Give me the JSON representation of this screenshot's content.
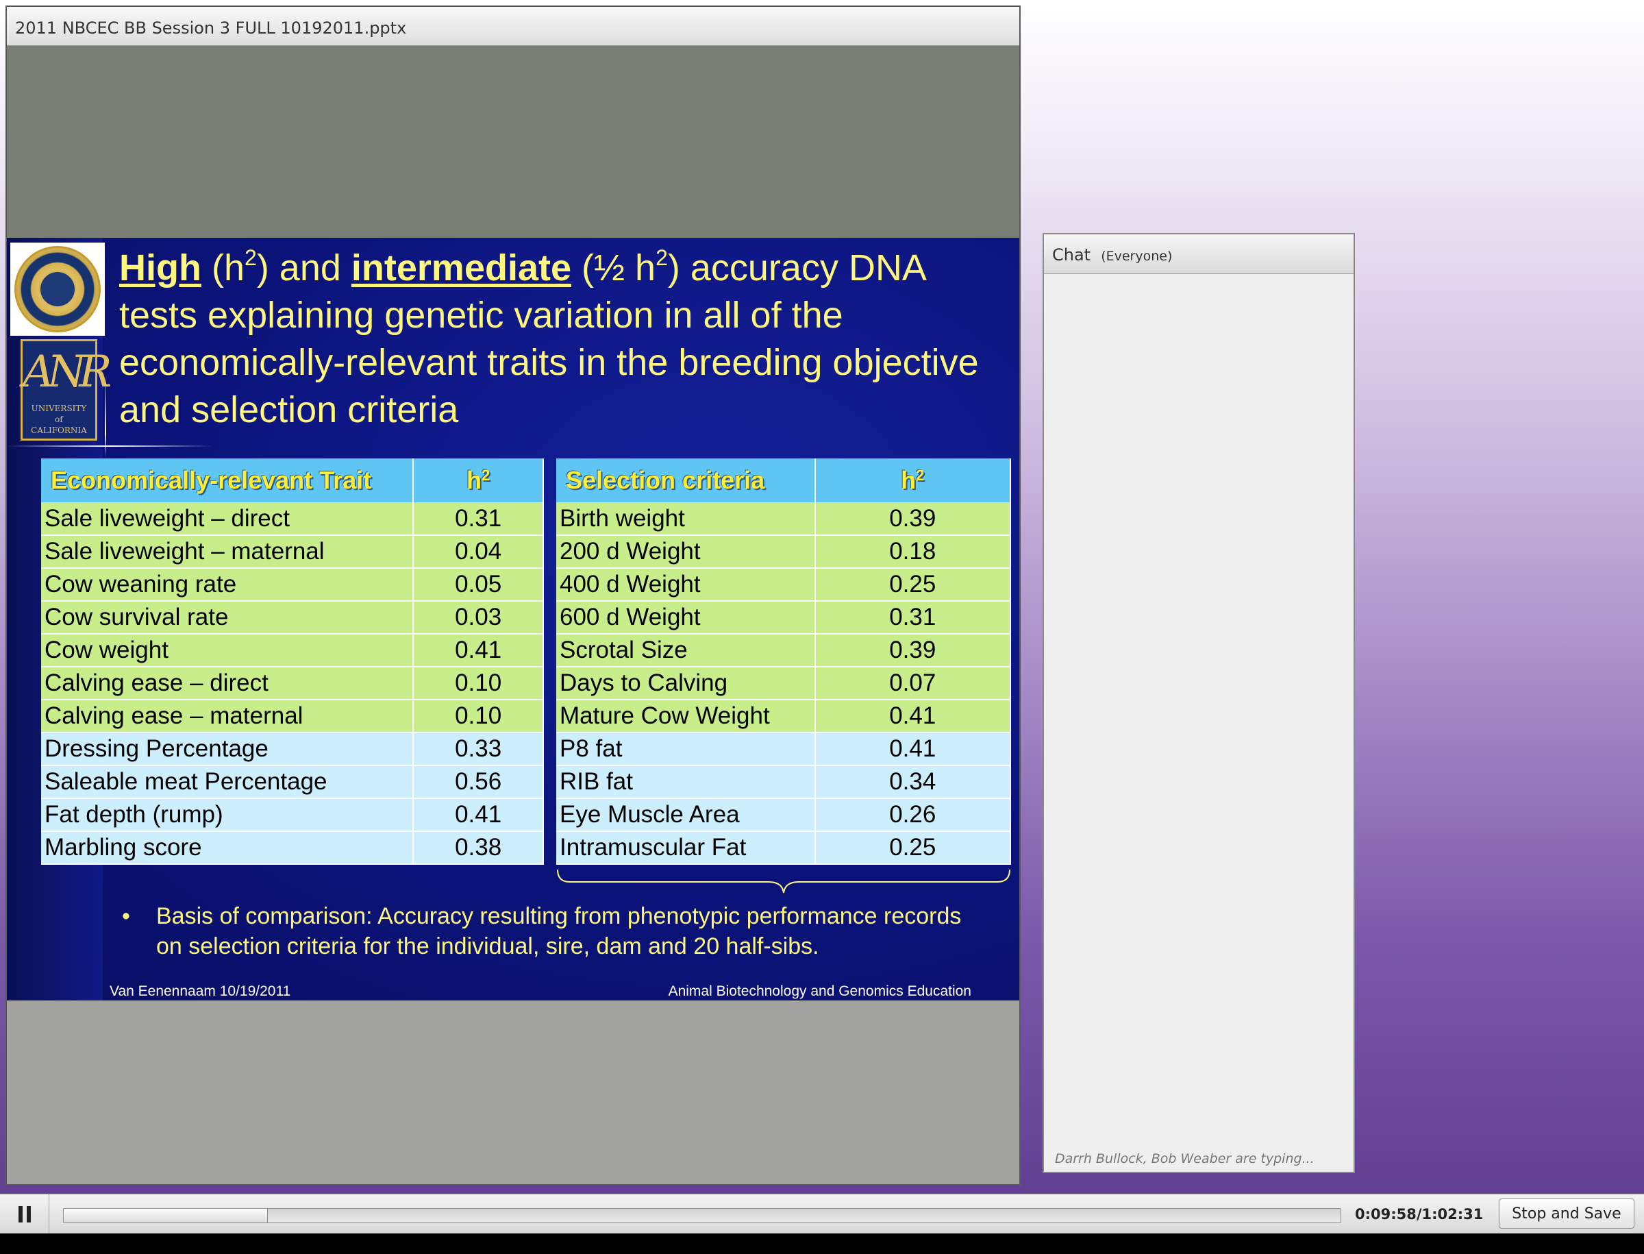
{
  "window": {
    "title": "2011 NBCEC BB Session 3 FULL 10192011.pptx"
  },
  "slide": {
    "title": {
      "high": "High",
      "h2_a_open": " (h",
      "sup_2": "2",
      "h2_a_close": ") and ",
      "intermediate": "intermediate",
      "h2_b_open": " (½ h",
      "h2_b_close": ") accuracy DNA tests explaining genetic variation in all of the economically-relevant traits in the breeding objective and selection criteria"
    },
    "left_table": {
      "headers": [
        "Economically-relevant Trait",
        "h2"
      ],
      "rows": [
        {
          "trait": "Sale liveweight – direct",
          "h2": "0.31",
          "group": "green"
        },
        {
          "trait": "Sale liveweight – maternal",
          "h2": "0.04",
          "group": "green"
        },
        {
          "trait": "Cow weaning rate",
          "h2": "0.05",
          "group": "green"
        },
        {
          "trait": "Cow survival rate",
          "h2": "0.03",
          "group": "green"
        },
        {
          "trait": "Cow weight",
          "h2": "0.41",
          "group": "green"
        },
        {
          "trait": "Calving ease – direct",
          "h2": "0.10",
          "group": "green"
        },
        {
          "trait": "Calving ease – maternal",
          "h2": "0.10",
          "group": "green"
        },
        {
          "trait": "Dressing Percentage",
          "h2": "0.33",
          "group": "blue"
        },
        {
          "trait": "Saleable meat Percentage",
          "h2": "0.56",
          "group": "blue"
        },
        {
          "trait": "Fat depth (rump)",
          "h2": "0.41",
          "group": "blue"
        },
        {
          "trait": "Marbling score",
          "h2": "0.38",
          "group": "blue"
        }
      ]
    },
    "right_table": {
      "headers": [
        "Selection criteria",
        "h2"
      ],
      "rows": [
        {
          "trait": "Birth weight",
          "h2": "0.39",
          "group": "green"
        },
        {
          "trait": "200 d Weight",
          "h2": "0.18",
          "group": "green"
        },
        {
          "trait": "400 d Weight",
          "h2": "0.25",
          "group": "green"
        },
        {
          "trait": "600 d Weight",
          "h2": "0.31",
          "group": "green"
        },
        {
          "trait": "Scrotal Size",
          "h2": "0.39",
          "group": "green"
        },
        {
          "trait": "Days to Calving",
          "h2": "0.07",
          "group": "green"
        },
        {
          "trait": "Mature Cow Weight",
          "h2": "0.41",
          "group": "green"
        },
        {
          "trait": "P8  fat",
          "h2": "0.41",
          "group": "blue"
        },
        {
          "trait": "RIB  fat",
          "h2": "0.34",
          "group": "blue"
        },
        {
          "trait": "Eye Muscle Area",
          "h2": "0.26",
          "group": "blue"
        },
        {
          "trait": "Intramuscular Fat",
          "h2": "0.25",
          "group": "blue"
        }
      ]
    },
    "basis": {
      "bullet": "•",
      "text": "Basis of comparison: Accuracy resulting from phenotypic performance records on selection criteria for the individual, sire, dam and 20 half-sibs."
    },
    "footer_left": "Van Eenennaam 10/19/2011",
    "footer_right": "Animal Biotechnology and Genomics Education",
    "logos": {
      "seal": "university-seal-logo",
      "anr": "ANR",
      "anr_sub": [
        "UNIVERSITY",
        "of",
        "CALIFORNIA"
      ]
    },
    "colors": {
      "title_yellow": "#fff67e",
      "header_blue": "#5fc6f3",
      "row_green": "#c8ee8c",
      "row_blue": "#cdeefd",
      "slide_bg": "#0b137a"
    }
  },
  "chat": {
    "title": "Chat",
    "scope": "(Everyone)",
    "typing": "Darrh Bullock, Bob Weaber are typing..."
  },
  "playback": {
    "pause_icon": "pause-icon",
    "progress_fraction": 0.16,
    "timecode": "0:09:58/1:02:31",
    "stop_save_label": "Stop and Save"
  }
}
